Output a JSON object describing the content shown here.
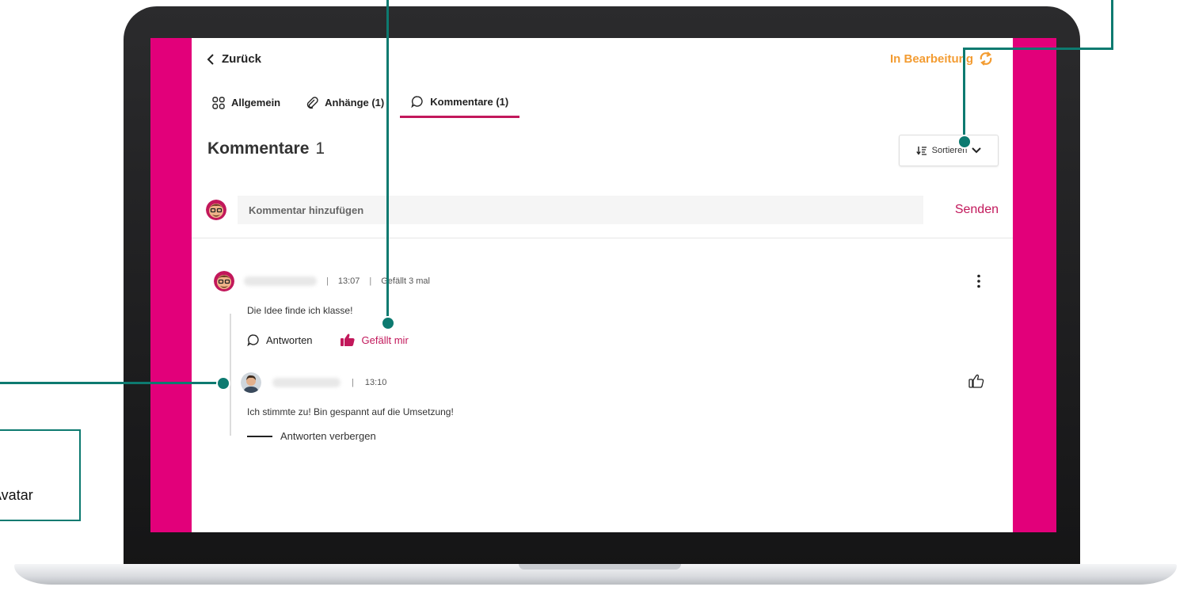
{
  "header": {
    "back_label": "Zurück",
    "status_label": "In Bearbeitung"
  },
  "tabs": [
    {
      "label": "Allgemein",
      "icon": "grid-icon"
    },
    {
      "label": "Anhänge (1)",
      "icon": "paperclip-icon"
    },
    {
      "label": "Kommentare (1)",
      "icon": "speech-bubble-icon"
    }
  ],
  "section": {
    "title": "Kommentare",
    "count": "1",
    "sort_label": "Sortieren"
  },
  "composer": {
    "placeholder": "Kommentar hinzufügen",
    "send_label": "Senden"
  },
  "comment": {
    "time": "13:07",
    "likes": "Gefällt 3 mal",
    "text": "Die Idee finde ich klasse!",
    "reply_action": "Antworten",
    "like_action": "Gefällt mir"
  },
  "reply": {
    "time": "13:10",
    "text": "Ich stimmte zu! Bin gespannt auf die Umsetzung!",
    "hide_label": "Antworten verbergen"
  },
  "callout": {
    "label": "Avatar"
  },
  "colors": {
    "accent_pink": "#e2007a",
    "brand": "#c2185b",
    "status": "#f39c32",
    "callout": "#0d7a70"
  }
}
